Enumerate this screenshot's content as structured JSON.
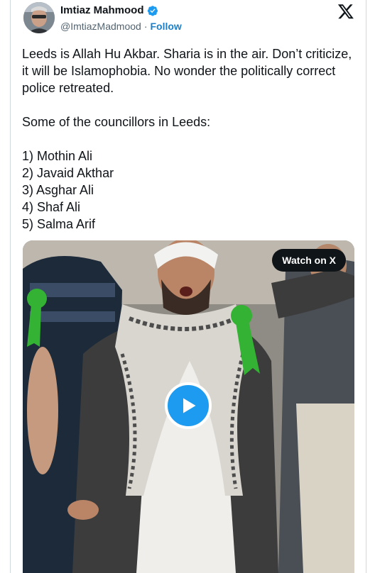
{
  "author": {
    "name": "Imtiaz Mahmood",
    "handle": "@ImtiazMadmood",
    "separator": "·",
    "follow_label": "Follow"
  },
  "tweet": {
    "text": "Leeds is Allah Hu Akbar. Sharia is in the air. Don’t criticize, it will be Islamophobia. No wonder the politically correct police retreated.\n\nSome of the councillors in Leeds:\n\n1) Mothin Ali\n2) Javaid Akthar\n3) Asghar Ali\n4) Shaf Ali\n5) Salma Arif"
  },
  "media": {
    "watch_label": "Watch on X"
  },
  "icons": {
    "verified": "verified-badge-icon",
    "logo": "x-logo-icon",
    "play": "play-icon"
  },
  "colors": {
    "accent": "#1d9bf0",
    "follow": "#1d7fc9",
    "secondary_text": "#536471"
  }
}
